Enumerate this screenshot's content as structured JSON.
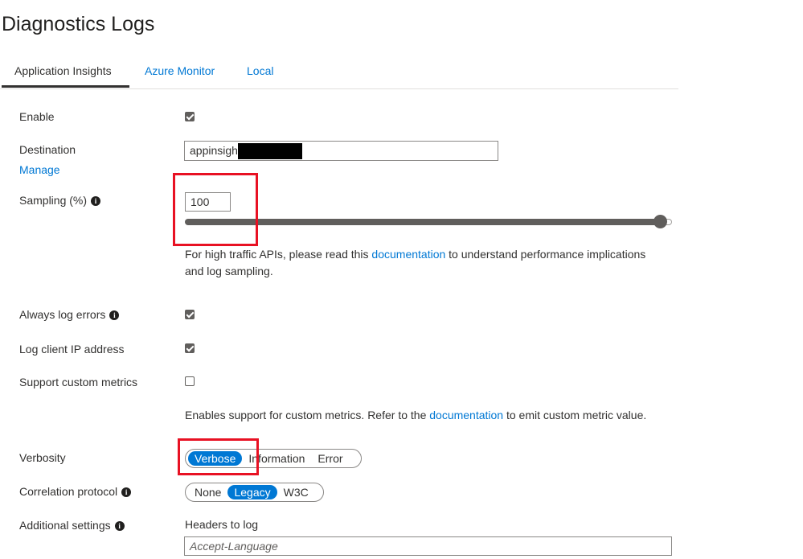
{
  "page": {
    "title": "Diagnostics Logs"
  },
  "tabs": [
    {
      "label": "Application Insights",
      "active": true
    },
    {
      "label": "Azure Monitor",
      "active": false
    },
    {
      "label": "Local",
      "active": false
    }
  ],
  "fields": {
    "enable": {
      "label": "Enable",
      "checked": true
    },
    "destination": {
      "label": "Destination",
      "manage_link": "Manage",
      "value": "appinsigh"
    },
    "sampling": {
      "label": "Sampling (%)",
      "value": "100",
      "level": 100,
      "help_prefix": "For high traffic APIs, please read this ",
      "help_link": "documentation",
      "help_suffix_line1": " to understand performance implications",
      "help_line2": "and log sampling."
    },
    "always_log_errors": {
      "label": "Always log errors",
      "checked": true
    },
    "log_client_ip": {
      "label": "Log client IP address",
      "checked": true
    },
    "custom_metrics": {
      "label": "Support custom metrics",
      "checked": false,
      "help_prefix": "Enables support for custom metrics. Refer to the ",
      "help_link": "documentation",
      "help_suffix": " to emit custom metric value."
    },
    "verbosity": {
      "label": "Verbosity",
      "options": [
        "Verbose",
        "Information",
        "Error"
      ],
      "selected": "Verbose"
    },
    "correlation": {
      "label": "Correlation protocol",
      "options": [
        "None",
        "Legacy",
        "W3C"
      ],
      "selected": "Legacy"
    },
    "additional": {
      "label": "Additional settings",
      "headers_label": "Headers to log",
      "headers_placeholder": "Accept-Language"
    }
  },
  "icons": {
    "info": "info-icon",
    "checkmark": "checkmark-icon"
  },
  "colors": {
    "accent": "#0078d4",
    "highlight_box": "#e81123",
    "text": "#323130"
  }
}
